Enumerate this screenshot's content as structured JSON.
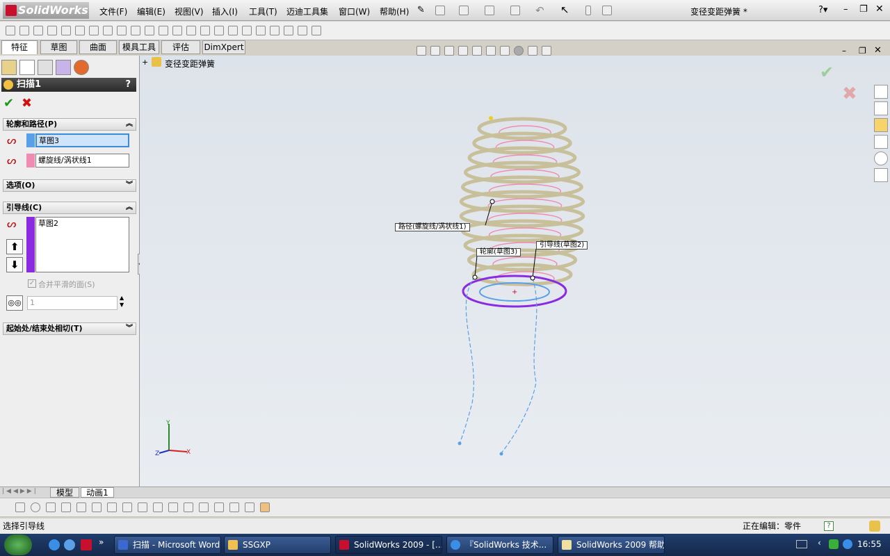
{
  "app": {
    "logo": "SolidWorks",
    "doc_title": "变径变距弹簧 *"
  },
  "menu": [
    "文件(F)",
    "编辑(E)",
    "视图(V)",
    "插入(I)",
    "工具(T)",
    "迈迪工具集",
    "窗口(W)",
    "帮助(H)"
  ],
  "tabs": [
    "特征",
    "草图",
    "曲面",
    "模具工具",
    "评估",
    "DimXpert"
  ],
  "tree_root": "变径变距弹簧",
  "panel": {
    "title": "扫描1",
    "help": "?",
    "sec_profile": "轮廓和路径(P)",
    "profile_value": "草图3",
    "path_value": "螺旋线/涡状线1",
    "sec_options": "选项(O)",
    "sec_guides": "引导线(C)",
    "guide_item": "草图2",
    "merge_label": "合并平滑的面(S)",
    "spin_value": "1",
    "sec_tangency": "起始处/结束处相切(T)"
  },
  "callouts": {
    "path": "路径(螺旋线/涡状线1)",
    "profile": "轮廓(草图3)",
    "guide": "引导线(草图2)"
  },
  "bottom_tabs": [
    "模型",
    "动画1"
  ],
  "status": {
    "left": "选择引导线",
    "editing": "正在编辑：零件"
  },
  "taskbar": {
    "items": [
      "扫描 - Microsoft Word",
      "SSGXP",
      "SolidWorks 2009 - [...",
      "『SolidWorks 技术...",
      "SolidWorks 2009 帮助"
    ],
    "clock": "16:55"
  },
  "colors": {
    "profile": "#5aa0e8",
    "path": "#f08cb4",
    "guide": "#8a2be2",
    "spring": "#c8c09a"
  }
}
